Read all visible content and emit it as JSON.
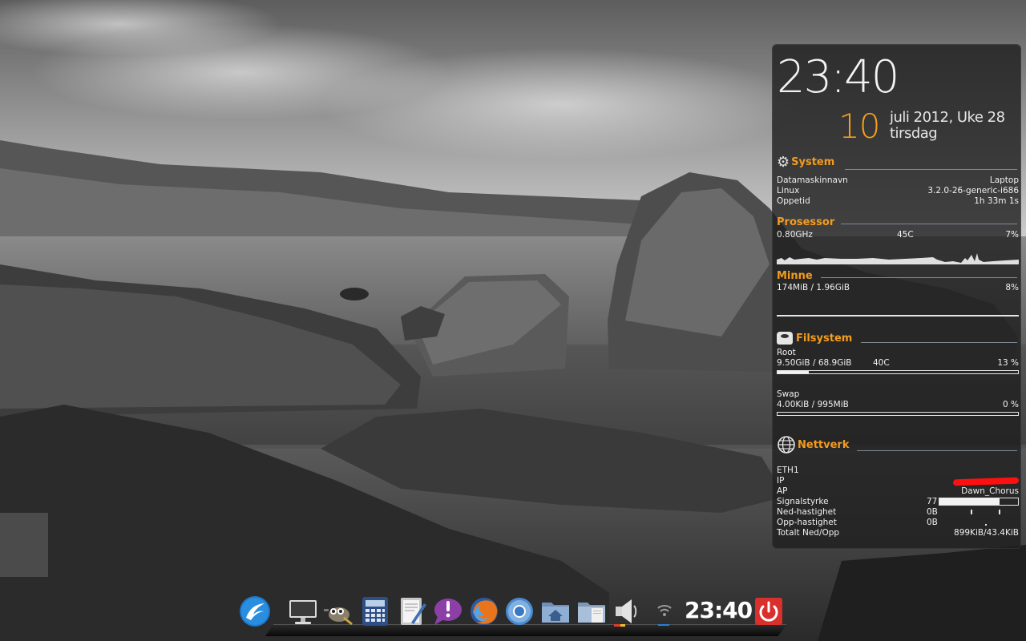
{
  "desktop": {
    "wallpaper": "black-and-white lake with rocks"
  },
  "conky": {
    "clock": "23:40",
    "day": "10",
    "date": "juli 2012, Uke 28",
    "weekday": "tirsdag",
    "accent_color": "#f39c1f",
    "system": {
      "title": "System",
      "icon": "gear-icon",
      "rows": [
        {
          "label": "Datamaskinnavn",
          "value": "Laptop"
        },
        {
          "label": "Linux",
          "value": "3.2.0-26-generic-i686"
        },
        {
          "label": "Oppetid",
          "value": "1h 33m 1s"
        }
      ]
    },
    "processor": {
      "title": "Prosessor",
      "freq": "0.80GHz",
      "temp": "45C",
      "usage": "7%"
    },
    "memory": {
      "title": "Minne",
      "used": "174MiB / 1.96GiB",
      "percent": "8%"
    },
    "filesystem": {
      "title": "Filsystem",
      "icon": "drive-icon",
      "root_label": "Root",
      "root_used": "9.50GiB / 68.9GiB",
      "root_temp": "40C",
      "root_percent": "13 %",
      "root_fill": 0.13,
      "swap_label": "Swap",
      "swap_used": "4.00KiB / 995MiB",
      "swap_percent": "0 %",
      "swap_fill": 0.0
    },
    "network": {
      "title": "Nettverk",
      "icon": "globe-icon",
      "iface": "ETH1",
      "ip_label": "IP",
      "ap_label": "AP",
      "ap_value": "Dawn_Chorus",
      "signal_label": "Signalstyrke",
      "signal_value": "77",
      "signal_fill": 0.77,
      "down_label": "Ned-hastighet",
      "down_value": "0B",
      "up_label": "Opp-hastighet",
      "up_value": "0B",
      "total_label": "Totalt Ned/Opp",
      "total_value": "899KiB/43.4KiB"
    }
  },
  "dock": {
    "items": [
      {
        "name": "lubuntu-menu-icon"
      },
      {
        "name": "monitor-icon"
      },
      {
        "name": "gimp-icon"
      },
      {
        "name": "calculator-icon"
      },
      {
        "name": "text-editor-icon"
      },
      {
        "name": "pidgin-icon"
      },
      {
        "name": "firefox-icon"
      },
      {
        "name": "chromium-icon"
      },
      {
        "name": "home-folder-icon"
      },
      {
        "name": "files-icon"
      },
      {
        "name": "volume-icon"
      },
      {
        "name": "wifi-icon"
      }
    ],
    "clock": "23:40",
    "power_color": "#d9302c"
  }
}
